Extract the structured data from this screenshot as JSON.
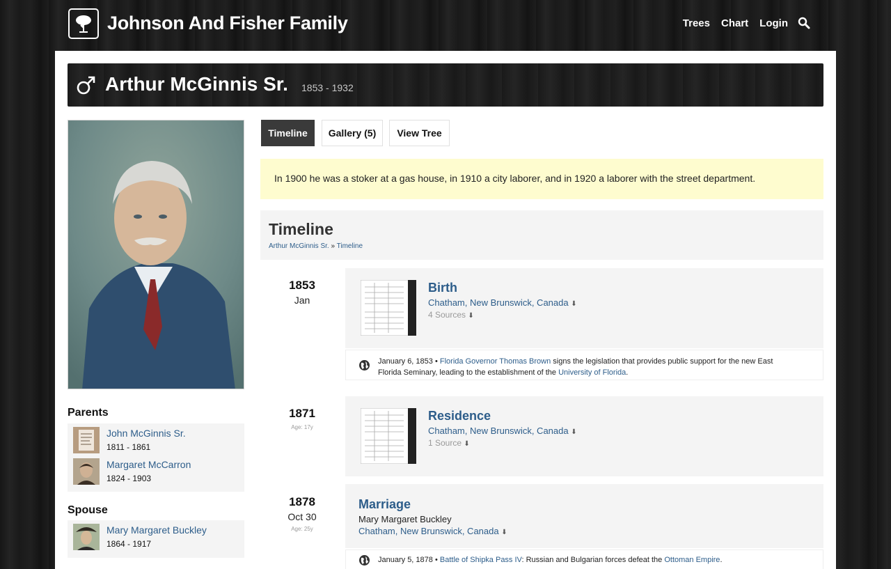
{
  "site": {
    "title": "Johnson And Fisher Family",
    "logo_icon": "tree-icon"
  },
  "nav": {
    "trees": "Trees",
    "chart": "Chart",
    "login": "Login",
    "search_icon": "search-icon"
  },
  "person": {
    "name": "Arthur McGinnis Sr.",
    "dates": "1853 - 1932",
    "gender_icon": "male-symbol-icon"
  },
  "tabs": {
    "timeline": "Timeline",
    "gallery": "Gallery (5)",
    "view_tree": "View Tree"
  },
  "note": "In 1900 he was a stoker at a gas house, in 1910 a city laborer, and in 1920 a laborer with the street department.",
  "timeline_header": {
    "title": "Timeline",
    "crumb_person": "Arthur McGinnis Sr.",
    "crumb_sep": " » ",
    "crumb_page": "Timeline"
  },
  "sidebar": {
    "parents_heading": "Parents",
    "parents": [
      {
        "name": "John McGinnis Sr.",
        "dates": "1811 - 1861"
      },
      {
        "name": "Margaret McCarron",
        "dates": "1824 - 1903"
      }
    ],
    "spouse_heading": "Spouse",
    "spouse": {
      "name": "Mary Margaret Buckley",
      "dates": "1864 - 1917"
    }
  },
  "events": [
    {
      "year": "1853",
      "month": "Jan",
      "age": "",
      "title": "Birth",
      "place": "Chatham, New Brunswick, Canada",
      "sources": "4 Sources",
      "sub": ""
    },
    {
      "year": "1871",
      "month": "",
      "age": "Age: 17y",
      "title": "Residence",
      "place": "Chatham, New Brunswick, Canada",
      "sources": "1 Source",
      "sub": ""
    },
    {
      "year": "1878",
      "month": "Oct 30",
      "age": "Age: 25y",
      "title": "Marriage",
      "place": "Chatham, New Brunswick, Canada",
      "sources": "",
      "sub": "Mary Margaret Buckley"
    }
  ],
  "world_events": [
    {
      "date": "January 6, 1853 •",
      "link1": "Florida Governor Thomas Brown",
      "text1": " signs the legislation that provides public support for the new East Florida Seminary, leading to the establishment of the ",
      "link2": "University of Florida",
      "text2": "."
    },
    {
      "date": "January 5, 1878 •",
      "link1": "Battle of Shipka Pass IV",
      "text1": ": Russian and Bulgarian forces defeat the ",
      "link2": "Ottoman Empire",
      "text2": "."
    }
  ],
  "colors": {
    "link": "#2d5d8a",
    "note_bg": "#fefccf",
    "active_tab": "#3a3a3a"
  }
}
